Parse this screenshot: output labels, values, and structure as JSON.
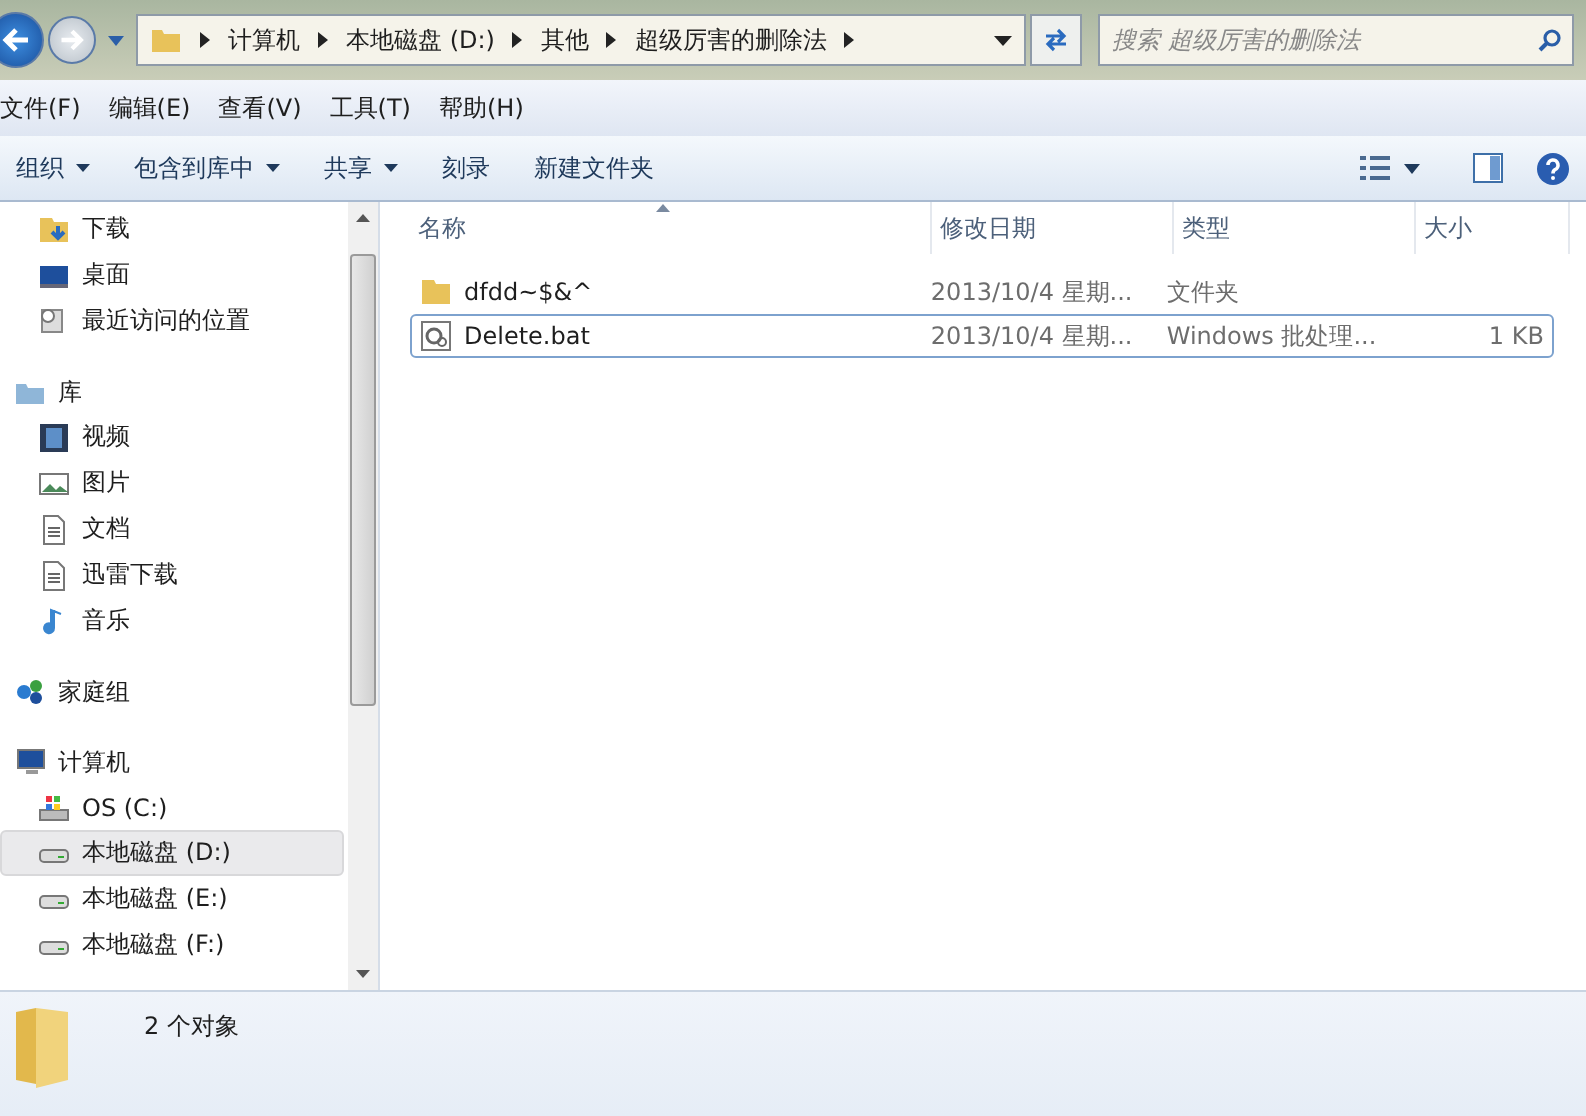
{
  "address_bar": {
    "crumbs": [
      "计算机",
      "本地磁盘 (D:)",
      "其他",
      "超级厉害的删除法"
    ]
  },
  "search": {
    "placeholder": "搜索 超级厉害的删除法"
  },
  "menu": [
    "文件(F)",
    "编辑(E)",
    "查看(V)",
    "工具(T)",
    "帮助(H)"
  ],
  "toolbar": [
    {
      "label": "组织",
      "dropdown": true
    },
    {
      "label": "包含到库中",
      "dropdown": true
    },
    {
      "label": "共享",
      "dropdown": true
    },
    {
      "label": "刻录",
      "dropdown": false
    },
    {
      "label": "新建文件夹",
      "dropdown": false
    }
  ],
  "nav": [
    {
      "items": [
        {
          "label": "下载",
          "kind": "download",
          "selected": false
        },
        {
          "label": "桌面",
          "kind": "desktop",
          "selected": false
        },
        {
          "label": "最近访问的位置",
          "kind": "recent",
          "selected": false
        }
      ]
    },
    {
      "header": {
        "label": "库",
        "kind": "library"
      },
      "items": [
        {
          "label": "视频",
          "kind": "video",
          "selected": false
        },
        {
          "label": "图片",
          "kind": "picture",
          "selected": false
        },
        {
          "label": "文档",
          "kind": "document",
          "selected": false
        },
        {
          "label": "迅雷下载",
          "kind": "document",
          "selected": false
        },
        {
          "label": "音乐",
          "kind": "music",
          "selected": false
        }
      ]
    },
    {
      "header": {
        "label": "家庭组",
        "kind": "homegroup"
      }
    },
    {
      "header": {
        "label": "计算机",
        "kind": "computer"
      },
      "items": [
        {
          "label": "OS (C:)",
          "kind": "system",
          "selected": false
        },
        {
          "label": "本地磁盘 (D:)",
          "kind": "drive",
          "selected": true
        },
        {
          "label": "本地磁盘 (E:)",
          "kind": "drive",
          "selected": false
        },
        {
          "label": "本地磁盘 (F:)",
          "kind": "drive",
          "selected": false
        }
      ]
    }
  ],
  "table": {
    "columns": [
      "名称",
      "修改日期",
      "类型",
      "大小"
    ],
    "rows": [
      {
        "name": "dfdd~$&^",
        "kind": "folder",
        "modified": "2013/10/4 星期...",
        "type": "文件夹",
        "selected": false
      },
      {
        "name": "Delete.bat",
        "kind": "batch",
        "modified": "2013/10/4 星期...",
        "type": "Windows 批处理...",
        "size": "1 KB",
        "selected": true
      }
    ]
  },
  "status_bar": {
    "count": "2 个对象"
  }
}
